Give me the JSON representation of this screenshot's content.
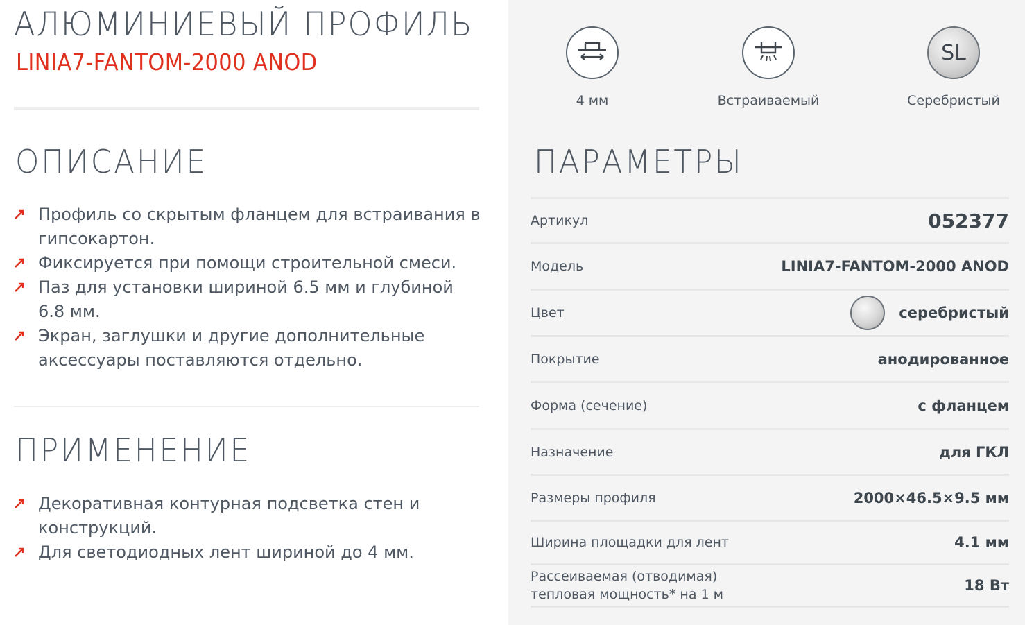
{
  "product": {
    "title": "АЛЮМИНИЕВЫЙ ПРОФИЛЬ",
    "model": "LINIA7-FANTOM-2000 ANOD"
  },
  "description": {
    "heading": "ОПИСАНИЕ",
    "items": [
      "Профиль со скрытым фланцем для встраивания в гипсокартон.",
      "Фиксируется при помощи строительной смеси.",
      "Паз для установки шириной 6.5 мм и глубиной 6.8 мм.",
      "Экран, заглушки и другие дополнительные аксессуары поставляются отдельно."
    ]
  },
  "application": {
    "heading": "ПРИМЕНЕНИЕ",
    "items": [
      "Декоративная контурная подсветка стен и конструкций.",
      "Для светодиодных лент шириной до 4 мм."
    ]
  },
  "features": [
    {
      "icon": "tape-width-icon",
      "label": "4 мм"
    },
    {
      "icon": "recessed-mount-icon",
      "label": "Встраиваемый"
    },
    {
      "icon": "silver-color-icon",
      "badge": "SL",
      "label": "Серебристый"
    }
  ],
  "parameters": {
    "heading": "ПАРАМЕТРЫ",
    "rows": [
      {
        "label": "Артикул",
        "value": "052377"
      },
      {
        "label": "Модель",
        "value": "LINIA7-FANTOM-2000 ANOD"
      },
      {
        "label": "Цвет",
        "value": "серебристый"
      },
      {
        "label": "Покрытие",
        "value": "анодированное"
      },
      {
        "label": "Форма (сечение)",
        "value": "с фланцем"
      },
      {
        "label": "Назначение",
        "value": "для ГКЛ"
      },
      {
        "label": "Размеры профиля",
        "value": "2000×46.5×9.5 мм"
      },
      {
        "label": "Ширина площадки для лент",
        "value": "4.1 мм"
      },
      {
        "label": "Рассеиваемая (отводимая)",
        "label2": "тепловая мощность* на 1 м",
        "value": "18 Вт"
      }
    ]
  },
  "colors": {
    "accent": "#e0301e",
    "text": "#4f5862",
    "panel": "#f4f4f5"
  }
}
